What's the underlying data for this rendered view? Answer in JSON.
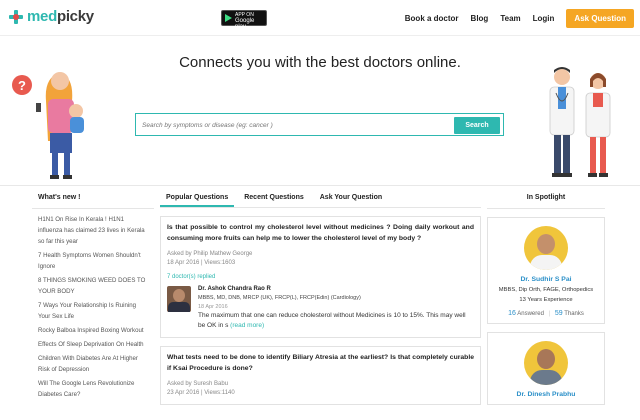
{
  "brand": {
    "name_a": "med",
    "name_b": "picky"
  },
  "store_badge": {
    "small": "ANDROID APP ON",
    "large": "Google play"
  },
  "nav": {
    "links": [
      "Book a doctor",
      "Blog",
      "Team",
      "Login"
    ],
    "cta": "Ask Question"
  },
  "hero": {
    "headline": "Connects you with the best doctors online.",
    "search_placeholder": "Search by symptoms or disease (eg: cancer )",
    "search_button": "Search"
  },
  "whats_new": {
    "title": "What's new !",
    "items": [
      "H1N1 On Rise In Kerala ! H1N1 influenza has claimed 23 lives in Kerala so far this year",
      "7 Health Symptoms Women Shouldn't Ignore",
      "8 THINGS SMOKING WEED DOES TO YOUR BODY",
      "7 Ways Your Relationship Is Ruining Your Sex Life",
      "Rocky Balboa Inspired Boxing Workout",
      "Effects Of Sleep Deprivation On Health",
      "Children With Diabetes Are At Higher Risk of Depression",
      "Will The Google Lens Revolutionize Diabetes Care?"
    ]
  },
  "tabs": [
    {
      "label": "Popular Questions",
      "active": true
    },
    {
      "label": "Recent Questions",
      "active": false
    },
    {
      "label": "Ask Your Question",
      "active": false
    }
  ],
  "questions": [
    {
      "title": "Is that possible to control my cholesterol level without medicines ? Doing daily workout and consuming more fruits can help me to lower the cholesterol level of my body ?",
      "asked_by": "Asked by Philip Mathew George",
      "stats": "18 Apr 2016 | Views:1603",
      "replied": "7 doctor(s) replied",
      "answer": {
        "doctor": "Dr. Ashok Chandra Rao R",
        "qualifications": "MBBS, MD, DNB, MRCP (UK), FRCP(L), FRCP(Edin) (Cardiology)",
        "date": "18 Apr 2016",
        "text": "The maximum that one can reduce cholesterol without Medicines is 10 to 15%. This may well be OK in s",
        "more": "(read more)"
      }
    },
    {
      "title": "What tests need to be done to identify Biliary Atresia at the earliest? Is that completely curable if Ksai Procedure is done?",
      "asked_by": "Asked by Suresh Babu",
      "stats": "23 Apr 2016 | Views:1140"
    }
  ],
  "spotlight": {
    "title": "In Spotlight",
    "doctors": [
      {
        "name": "Dr. Sudhir S Pai",
        "qualifications": "MBBS, Dip Orth, FAGE, Orthopedics",
        "experience": "13 Years Experience",
        "answered_count": "16",
        "answered_label": "Answered",
        "thanks_count": "59",
        "thanks_label": "Thanks"
      },
      {
        "name": "Dr. Dinesh Prabhu"
      }
    ]
  },
  "colors": {
    "accent": "#2eb8b0",
    "cta": "#f5a623",
    "link_blue": "#2a8fc8"
  }
}
